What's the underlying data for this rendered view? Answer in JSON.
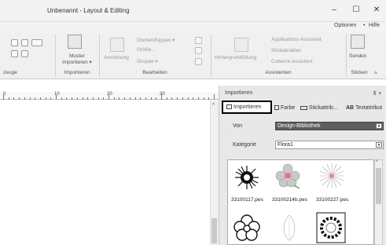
{
  "window": {
    "title": "Unbenannt - Layout & Editing",
    "minimize": "–",
    "maximize": "☐",
    "close": "✕"
  },
  "menu": {
    "options": "Optionen",
    "dot": "•",
    "help": "Hilfe"
  },
  "ribbon": {
    "groups": [
      {
        "label": "zeuge"
      },
      {
        "label": "Importieren"
      },
      {
        "label": "Bearbeiten"
      },
      {
        "label": "Assistenten"
      },
      {
        "label": "Sticken"
      }
    ],
    "muster_importieren": "Muster importieren",
    "muster_line1": "Muster",
    "muster_line2": "importieren ▾",
    "anordnung": "Anordnung",
    "drehen": "Drehen/Kippen ▾",
    "groesse": "Größe...",
    "gruppe": "Gruppe ▾",
    "hintergrundfuellung": "Hintergrundfüllung",
    "applikation": "Applikations-Assistent",
    "stickabnaeher": "Stickabnäher",
    "cutwork": "Cutwork-Assistent",
    "senden": "Senden"
  },
  "ruler": {
    "marks": [
      "0",
      "10",
      "20",
      "30"
    ]
  },
  "panel": {
    "title": "Importieren",
    "pin": "⊼ ×",
    "tabs": {
      "importieren": "Importieren",
      "farbe": "Farbe",
      "stickattrib": "Stickattrib...",
      "textattribut": "Textattribut"
    },
    "von": {
      "label": "Von",
      "value": "Design-Bibliothek"
    },
    "kategorie": {
      "label": "Kategorie",
      "value": "Flora1"
    },
    "files": [
      {
        "name": "33100117.pes"
      },
      {
        "name": "33100214b.pes"
      },
      {
        "name": "33100227.pes"
      }
    ]
  },
  "icons": {
    "arrow": "▾",
    "collapse": "^"
  }
}
